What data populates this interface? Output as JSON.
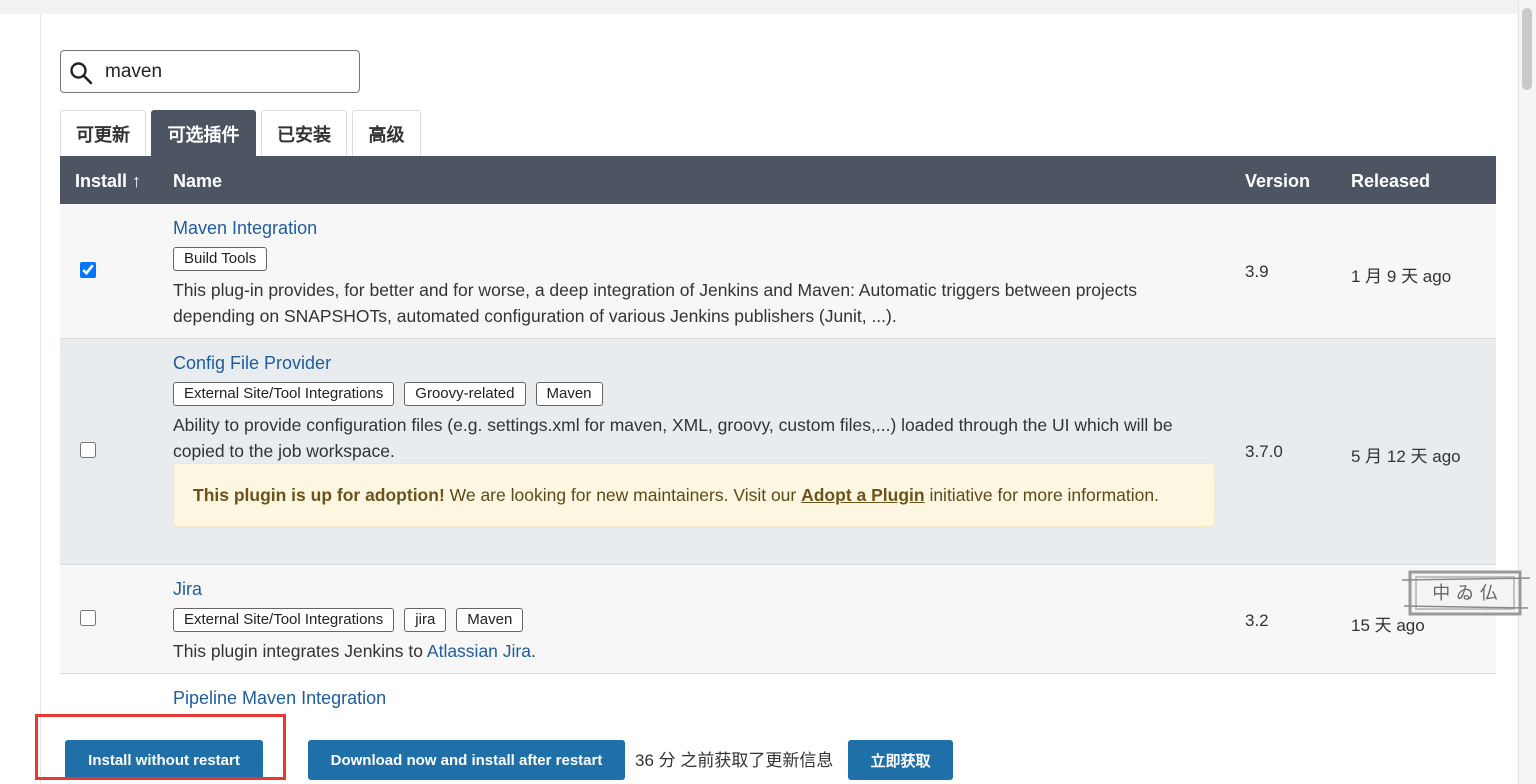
{
  "search": {
    "value": "maven",
    "icon": "search-icon"
  },
  "tabs": [
    {
      "label": "可更新",
      "active": false
    },
    {
      "label": "可选插件",
      "active": true
    },
    {
      "label": "已安装",
      "active": false
    },
    {
      "label": "高级",
      "active": false
    }
  ],
  "table": {
    "headers": {
      "install": "Install ↑",
      "name": "Name",
      "version": "Version",
      "released": "Released"
    },
    "rows": [
      {
        "name": "Maven Integration",
        "checked": true,
        "tags": [
          "Build Tools"
        ],
        "description": "This plug-in provides, for better and for worse, a deep integration of Jenkins and Maven: Automatic triggers between projects depending on SNAPSHOTs, automated configuration of various Jenkins publishers (Junit, ...).",
        "version": "3.9",
        "released": "1 月 9 天 ago"
      },
      {
        "name": "Config File Provider",
        "checked": false,
        "tags": [
          "External Site/Tool Integrations",
          "Groovy-related",
          "Maven"
        ],
        "description": "Ability to provide configuration files (e.g. settings.xml for maven, XML, groovy, custom files,...) loaded through the UI which will be copied to the job workspace.",
        "adoption": {
          "bold": "This plugin is up for adoption!",
          "text1": " We are looking for new maintainers. Visit our ",
          "link": "Adopt a Plugin",
          "text2": " initiative for more information."
        },
        "version": "3.7.0",
        "released": "5 月 12 天 ago"
      },
      {
        "name": "Jira",
        "checked": false,
        "tags": [
          "External Site/Tool Integrations",
          "jira",
          "Maven"
        ],
        "description_prefix": "This plugin integrates Jenkins to ",
        "description_link": "Atlassian Jira",
        "description_suffix": ".",
        "version": "3.2",
        "released": "15 天 ago"
      },
      {
        "name": "Pipeline Maven Integration"
      }
    ]
  },
  "footer": {
    "install_without_restart": "Install without restart",
    "download_install_after_restart": "Download now and install after restart",
    "status": "36 分 之前获取了更新信息",
    "fetch_now": "立即获取"
  },
  "stamp": {
    "text": "中 ゐ 仏"
  },
  "colors": {
    "header_bg": "#4e5562",
    "link": "#1f5c9e",
    "button": "#1f6fa8",
    "highlight_row": "#e8ecef",
    "annotation": "#e53935"
  }
}
